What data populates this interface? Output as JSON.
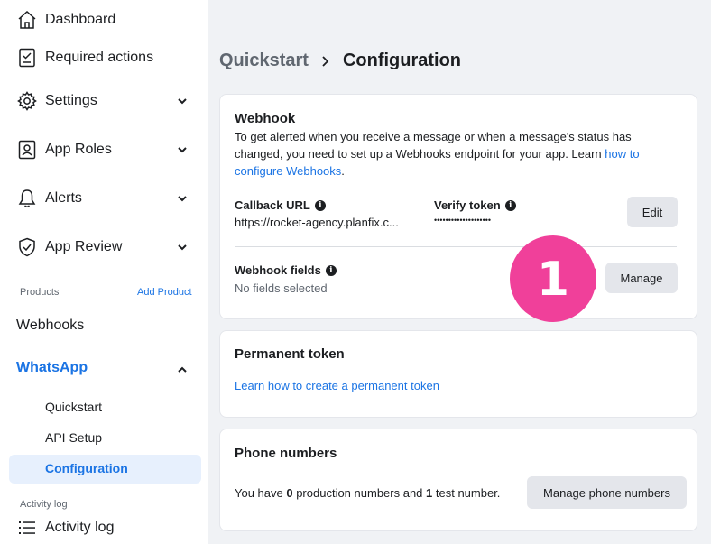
{
  "sidebar": {
    "dashboard": "Dashboard",
    "required_actions": "Required actions",
    "settings": "Settings",
    "app_roles": "App Roles",
    "alerts": "Alerts",
    "app_review": "App Review",
    "products_label": "Products",
    "add_product": "Add Product",
    "webhooks": "Webhooks",
    "whatsapp": "WhatsApp",
    "whatsapp_sub": [
      "Quickstart",
      "API Setup",
      "Configuration"
    ],
    "activity_log_label": "Activity log",
    "activity_log": "Activity log"
  },
  "breadcrumb": {
    "first": "Quickstart",
    "current": "Configuration"
  },
  "webhook_card": {
    "title": "Webhook",
    "desc_line1": "To get alerted when you receive a message or when a message's status has",
    "desc_line2": "changed,  you need to set up a Webhooks endpoint for your app. Learn ",
    "desc_link_a": "how to",
    "desc_link_b": "configure Webhooks",
    "desc_end": ".",
    "callback_label": "Callback URL",
    "callback_value": "https://rocket-agency.planfix.c...",
    "verify_label": "Verify token",
    "verify_value": "••••••••••••••••••••",
    "edit_button": "Edit",
    "fields_label": "Webhook fields",
    "fields_value": "No fields selected",
    "manage_button": "Manage"
  },
  "annotation": {
    "number": "1",
    "color": "#f0409a"
  },
  "permanent_card": {
    "title": "Permanent token",
    "link": "Learn how to create a permanent token"
  },
  "phone_card": {
    "title": "Phone numbers",
    "text_a": "You have ",
    "production_count": "0",
    "text_b": " production numbers and ",
    "test_count": "1",
    "text_c": " test number.",
    "manage_button": "Manage phone numbers"
  },
  "colors": {
    "accent": "#1b74e4",
    "active_bg": "#e7f0fd"
  }
}
